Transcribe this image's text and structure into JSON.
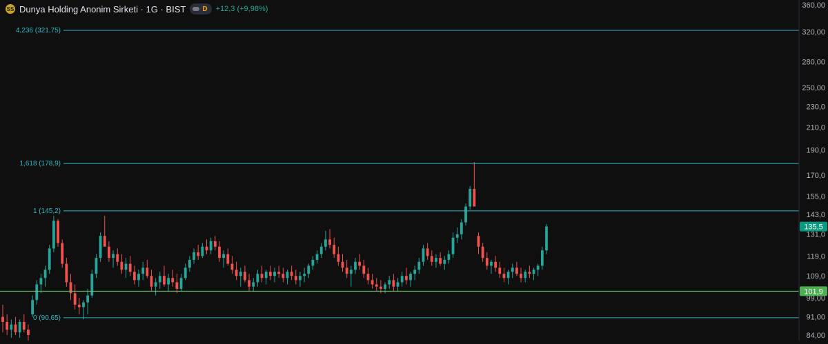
{
  "header": {
    "logo_text": "SS",
    "title": "Dunya Holding Anonim Sirketi · 1G · BIST",
    "pill_letter": "D",
    "change": "+12,3 (+9,98%)"
  },
  "colors": {
    "background": "#0f0f0f",
    "up": "#26a69a",
    "down": "#ef5350",
    "fib_line": "#2fb9c4",
    "support_line": "#62c462",
    "axis_text": "#b2b5be"
  },
  "chart_data": {
    "type": "candlestick",
    "y_scale": "log",
    "y_ticks": [
      {
        "value": 360,
        "label": "360,00"
      },
      {
        "value": 320,
        "label": "320,00"
      },
      {
        "value": 280,
        "label": "280,00"
      },
      {
        "value": 250,
        "label": "250,00"
      },
      {
        "value": 230,
        "label": "230,0"
      },
      {
        "value": 210,
        "label": "210,0"
      },
      {
        "value": 190,
        "label": "190,0"
      },
      {
        "value": 170,
        "label": "170,0"
      },
      {
        "value": 155,
        "label": "155,0"
      },
      {
        "value": 143,
        "label": "143,0"
      },
      {
        "value": 131,
        "label": "131,0"
      },
      {
        "value": 119,
        "label": "119,0"
      },
      {
        "value": 109,
        "label": "109,0"
      },
      {
        "value": 99,
        "label": "99,00"
      },
      {
        "value": 91,
        "label": "91,00"
      },
      {
        "value": 84,
        "label": "84,00"
      }
    ],
    "fib_levels": [
      {
        "label": "4,236 (321,75)",
        "value": 321.75
      },
      {
        "label": "1,618 (178,9)",
        "value": 178.9
      },
      {
        "label": "1 (145,2)",
        "value": 145.2
      },
      {
        "label": "0 (90,65)",
        "value": 90.65
      }
    ],
    "horizontal_line": {
      "value": 101.9,
      "label": "101,9"
    },
    "last_price": {
      "value": 135.5,
      "label": "135,5"
    },
    "candles": [
      [
        91,
        96,
        85,
        89
      ],
      [
        89,
        92,
        84,
        86
      ],
      [
        86,
        90,
        83,
        88
      ],
      [
        88,
        91,
        84,
        85
      ],
      [
        85,
        90,
        83,
        89
      ],
      [
        89,
        92,
        85,
        86
      ],
      [
        86,
        88,
        82,
        84
      ],
      [
        92,
        100,
        91,
        98
      ],
      [
        98,
        107,
        96,
        105
      ],
      [
        105,
        110,
        101,
        108
      ],
      [
        108,
        114,
        104,
        112
      ],
      [
        112,
        125,
        110,
        123
      ],
      [
        123,
        142,
        121,
        139
      ],
      [
        139,
        140,
        124,
        126
      ],
      [
        126,
        128,
        113,
        115
      ],
      [
        115,
        118,
        104,
        106
      ],
      [
        106,
        110,
        98,
        101
      ],
      [
        101,
        105,
        94,
        96
      ],
      [
        96,
        99,
        92,
        95
      ],
      [
        95,
        98,
        90,
        97
      ],
      [
        97,
        103,
        92,
        100
      ],
      [
        100,
        112,
        99,
        110
      ],
      [
        110,
        120,
        108,
        118
      ],
      [
        118,
        132,
        116,
        130
      ],
      [
        130,
        142,
        128,
        124
      ],
      [
        124,
        127,
        116,
        118
      ],
      [
        118,
        122,
        113,
        120
      ],
      [
        120,
        123,
        114,
        116
      ],
      [
        116,
        120,
        110,
        112
      ],
      [
        112,
        118,
        108,
        115
      ],
      [
        115,
        119,
        109,
        111
      ],
      [
        111,
        114,
        105,
        107
      ],
      [
        107,
        112,
        104,
        110
      ],
      [
        110,
        116,
        107,
        113
      ],
      [
        113,
        117,
        108,
        109
      ],
      [
        109,
        112,
        102,
        104
      ],
      [
        104,
        108,
        100,
        106
      ],
      [
        106,
        111,
        103,
        109
      ],
      [
        109,
        114,
        104,
        105
      ],
      [
        105,
        110,
        102,
        108
      ],
      [
        108,
        112,
        104,
        106
      ],
      [
        106,
        110,
        101,
        103
      ],
      [
        103,
        110,
        102,
        108
      ],
      [
        108,
        115,
        107,
        113
      ],
      [
        113,
        119,
        111,
        117
      ],
      [
        117,
        123,
        115,
        121
      ],
      [
        121,
        125,
        117,
        119
      ],
      [
        119,
        126,
        118,
        124
      ],
      [
        124,
        128,
        120,
        122
      ],
      [
        122,
        129,
        120,
        127
      ],
      [
        127,
        130,
        122,
        124
      ],
      [
        124,
        127,
        116,
        118
      ],
      [
        118,
        122,
        113,
        120
      ],
      [
        120,
        123,
        114,
        115
      ],
      [
        115,
        119,
        110,
        112
      ],
      [
        112,
        116,
        107,
        109
      ],
      [
        109,
        113,
        104,
        111
      ],
      [
        111,
        114,
        106,
        107
      ],
      [
        107,
        110,
        102,
        104
      ],
      [
        104,
        108,
        102,
        106
      ],
      [
        106,
        112,
        104,
        110
      ],
      [
        110,
        114,
        106,
        108
      ],
      [
        108,
        112,
        105,
        111
      ],
      [
        111,
        114,
        107,
        109
      ],
      [
        109,
        113,
        106,
        111
      ],
      [
        111,
        114,
        108,
        110
      ],
      [
        110,
        113,
        106,
        108
      ],
      [
        108,
        112,
        105,
        111
      ],
      [
        111,
        114,
        107,
        109
      ],
      [
        109,
        112,
        105,
        107
      ],
      [
        107,
        111,
        104,
        109
      ],
      [
        109,
        113,
        106,
        110
      ],
      [
        110,
        115,
        108,
        114
      ],
      [
        114,
        119,
        112,
        117
      ],
      [
        117,
        122,
        115,
        120
      ],
      [
        120,
        126,
        118,
        124
      ],
      [
        124,
        133,
        122,
        128
      ],
      [
        128,
        134,
        123,
        125
      ],
      [
        125,
        129,
        118,
        120
      ],
      [
        120,
        124,
        114,
        116
      ],
      [
        116,
        120,
        111,
        113
      ],
      [
        113,
        117,
        108,
        110
      ],
      [
        110,
        114,
        104,
        112
      ],
      [
        112,
        118,
        110,
        116
      ],
      [
        116,
        120,
        112,
        114
      ],
      [
        114,
        117,
        108,
        110
      ],
      [
        110,
        113,
        105,
        107
      ],
      [
        107,
        110,
        103,
        105
      ],
      [
        105,
        108,
        102,
        104
      ],
      [
        104,
        107,
        101,
        103
      ],
      [
        103,
        106,
        101,
        105
      ],
      [
        105,
        109,
        103,
        107
      ],
      [
        107,
        110,
        102,
        104
      ],
      [
        104,
        108,
        102,
        106
      ],
      [
        106,
        111,
        104,
        109
      ],
      [
        109,
        113,
        105,
        107
      ],
      [
        107,
        111,
        104,
        110
      ],
      [
        110,
        114,
        107,
        112
      ],
      [
        112,
        118,
        110,
        116
      ],
      [
        116,
        125,
        114,
        123
      ],
      [
        123,
        126,
        117,
        119
      ],
      [
        119,
        122,
        114,
        116
      ],
      [
        116,
        120,
        113,
        118
      ],
      [
        118,
        121,
        114,
        115
      ],
      [
        115,
        119,
        112,
        117
      ],
      [
        117,
        122,
        115,
        120
      ],
      [
        120,
        132,
        118,
        129
      ],
      [
        129,
        135,
        126,
        131
      ],
      [
        131,
        140,
        128,
        138
      ],
      [
        138,
        150,
        136,
        148
      ],
      [
        148,
        162,
        146,
        160
      ],
      [
        160,
        180,
        158,
        148
      ],
      [
        130,
        132,
        120,
        124
      ],
      [
        124,
        126,
        116,
        118
      ],
      [
        118,
        121,
        112,
        114
      ],
      [
        114,
        117,
        110,
        116
      ],
      [
        116,
        119,
        111,
        113
      ],
      [
        113,
        116,
        108,
        110
      ],
      [
        110,
        113,
        106,
        108
      ],
      [
        108,
        112,
        105,
        111
      ],
      [
        111,
        115,
        108,
        113
      ],
      [
        113,
        116,
        109,
        110
      ],
      [
        110,
        113,
        106,
        108
      ],
      [
        108,
        112,
        106,
        111
      ],
      [
        111,
        114,
        108,
        110
      ],
      [
        110,
        113,
        107,
        112
      ],
      [
        112,
        115,
        109,
        114
      ],
      [
        114,
        124,
        112,
        122
      ],
      [
        122,
        137,
        120,
        135.5
      ]
    ]
  }
}
